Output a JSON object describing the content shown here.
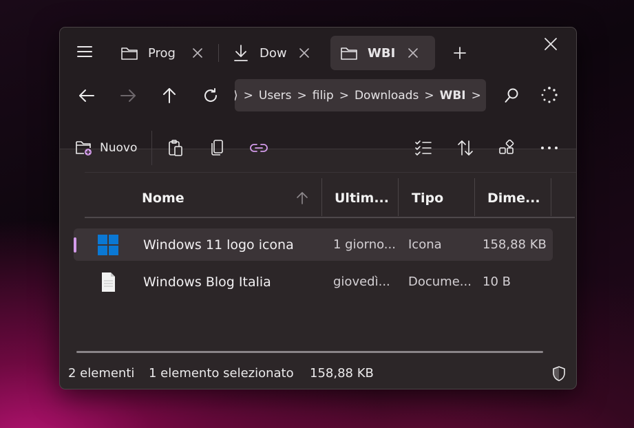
{
  "tabs": [
    {
      "label": "Prog",
      "icon": "folder-icon",
      "active": false
    },
    {
      "label": "Dow",
      "icon": "download-icon",
      "active": false
    },
    {
      "label": "WBI",
      "icon": "folder-icon",
      "active": true
    }
  ],
  "breadcrumb": [
    "Users",
    "filip",
    "Downloads",
    "WBI"
  ],
  "toolbar": {
    "new_label": "Nuovo"
  },
  "columns": [
    "Nome",
    "Ultim...",
    "Tipo",
    "Dime..."
  ],
  "files": [
    {
      "name": "Windows 11 logo icona",
      "modified": "1 giorno...",
      "type": "Icona",
      "size": "158,88 KB",
      "icon": "windows-logo-icon",
      "selected": true
    },
    {
      "name": "Windows Blog Italia",
      "modified": "giovedì...",
      "type": "Docume...",
      "size": "10 B",
      "icon": "document-icon",
      "selected": false
    }
  ],
  "status": {
    "count": "2 elementi",
    "selection": "1 elemento selezionato",
    "size": "158,88 KB"
  },
  "colors": {
    "accent": "#d39bea",
    "windows_blue": "#0a78d4"
  }
}
